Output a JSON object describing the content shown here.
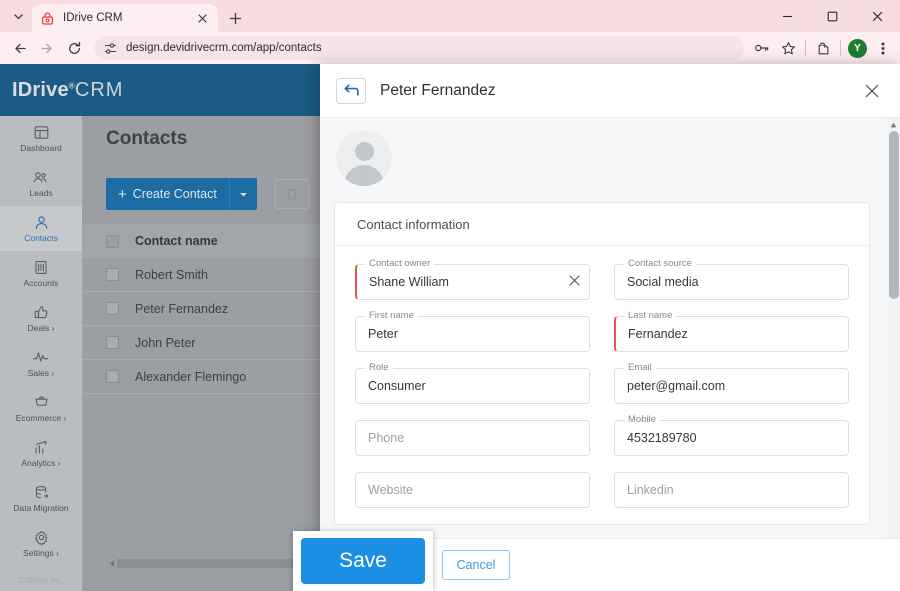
{
  "browser": {
    "tab": {
      "title": "IDrive CRM",
      "favicon_icon": "idrive-lock-icon",
      "close_icon": "close-icon"
    },
    "tab_list_icon": "chevron-down-icon",
    "new_tab_icon": "plus-icon",
    "window": {
      "minimize": "minimize-icon",
      "maximize": "maximize-icon",
      "close": "close-icon"
    },
    "nav": {
      "back_icon": "back-arrow-icon",
      "forward_icon": "forward-arrow-icon",
      "reload_icon": "reload-icon"
    },
    "omnibox": {
      "site_settings_icon": "tune-icon",
      "url": "design.devidrivecrm.com/app/contacts"
    },
    "actions": {
      "password_icon": "key-icon",
      "bookmark_icon": "star-icon",
      "extensions_icon": "puzzle-piece-icon",
      "profile_initial": "Y",
      "menu_icon": "three-dot-menu-icon"
    }
  },
  "app": {
    "brand": {
      "name": "IDriv",
      "mark": "e",
      "reg": "®",
      "suffix": "CRM"
    },
    "sidebar": {
      "items": [
        {
          "label": "Dashboard",
          "icon": "dashboard-icon",
          "active": false,
          "arrow": ""
        },
        {
          "label": "Leads",
          "icon": "leads-icon",
          "active": false,
          "arrow": ""
        },
        {
          "label": "Contacts",
          "icon": "contacts-icon",
          "active": true,
          "arrow": ""
        },
        {
          "label": "Accounts",
          "icon": "accounts-icon",
          "active": false,
          "arrow": ""
        },
        {
          "label": "Deals",
          "icon": "deals-thumbsup-icon",
          "active": false,
          "arrow": "›"
        },
        {
          "label": "Sales",
          "icon": "sales-pulse-icon",
          "active": false,
          "arrow": "›"
        },
        {
          "label": "Ecommerce",
          "icon": "ecommerce-cart-icon",
          "active": false,
          "arrow": "›"
        },
        {
          "label": "Analytics",
          "icon": "analytics-chart-icon",
          "active": false,
          "arrow": "›"
        },
        {
          "label": "Data Migration",
          "icon": "data-migration-icon",
          "active": false,
          "arrow": ""
        },
        {
          "label": "Settings",
          "icon": "gear-icon",
          "active": false,
          "arrow": "›"
        }
      ],
      "copyright": "© IDrive Inc."
    },
    "page": {
      "title": "Contacts",
      "create_button": {
        "label": "Create Contact",
        "plus": "+",
        "caret_icon": "chevron-down-icon"
      },
      "delete_icon": "trash-icon",
      "table": {
        "header": "Contact name",
        "rows": [
          {
            "name": "Robert Smith"
          },
          {
            "name": "Peter Fernandez"
          },
          {
            "name": "John Peter"
          },
          {
            "name": "Alexander Flemingo"
          }
        ]
      },
      "hscroll_left_icon": "scroll-left-arrow-icon"
    }
  },
  "modal": {
    "back_icon": "back-arrow-icon",
    "title": "Peter Fernandez",
    "close_icon": "close-icon",
    "avatar_icon": "person-avatar-icon",
    "card": {
      "heading": "Contact information",
      "rows": [
        [
          {
            "label": "Contact owner",
            "value": "Shane William",
            "required": true,
            "placeholder": false,
            "clear_icon": "clear-x-icon"
          },
          {
            "label": "Contact source",
            "value": "Social media",
            "required": false,
            "placeholder": false
          }
        ],
        [
          {
            "label": "First name",
            "value": "Peter",
            "required": false,
            "placeholder": false
          },
          {
            "label": "Last name",
            "value": "Fernandez",
            "required": true,
            "placeholder": false
          }
        ],
        [
          {
            "label": "Role",
            "value": "Consumer",
            "required": false,
            "placeholder": false
          },
          {
            "label": "Email",
            "value": "peter@gmail.com",
            "required": false,
            "placeholder": false
          }
        ],
        [
          {
            "label": "",
            "value": "Phone",
            "required": false,
            "placeholder": true
          },
          {
            "label": "Mobile",
            "value": "4532189780",
            "required": false,
            "placeholder": false
          }
        ],
        [
          {
            "label": "",
            "value": "Website",
            "required": false,
            "placeholder": true
          },
          {
            "label": "",
            "value": "Linkedin",
            "required": false,
            "placeholder": true
          }
        ]
      ]
    },
    "footer": {
      "save_label": "Save",
      "cancel_label": "Cancel"
    },
    "callout_save_label": "Save",
    "scroll_up_icon": "scroll-up-arrow-icon"
  },
  "colors": {
    "brand_blue": "#1b5b85",
    "accent_blue": "#1a8fe3",
    "required_red": "#e8564a",
    "chrome_pink": "#fdeef1",
    "profile_green": "#1e7b32"
  }
}
